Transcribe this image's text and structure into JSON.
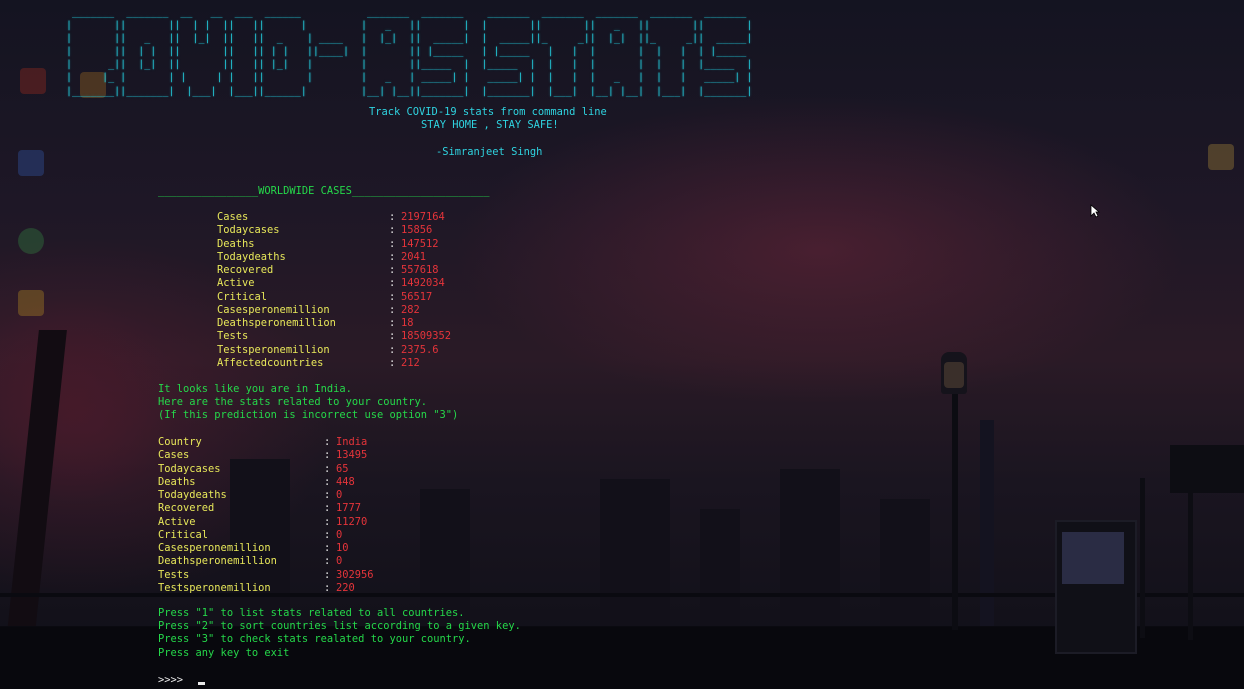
{
  "banner": {
    "ascii_art": " _______  _______  __   __  ___  ______           _______  _______    _______  _______  _______  _______  _______ \n|       ||       ||  | |  ||   ||      |         |   _   ||       |  |       ||       ||   _   ||       ||       |\n|       ||   _   ||  |_|  ||   ||  _    | ____   |  |_|  ||  _____|  |  _____||_     _||  |_|  ||_     _||  _____|\n|       ||  | |  ||       ||   || | |   ||____|  |       || |_____   | |_____   |   |  |       |  |   |  | |_____ \n|      _||  |_|  ||       ||   || |_|   |        |       ||_____  |  |_____  |  |   |  |       |  |   |  |_____  |\n|     |_ |       | |     | |   ||       |        |   _   | _____| |   _____| |  |   |  |   _   |  |   |   _____| |\n|_______||_______|  |___|  |___||______|         |__| |__||_______|  |_______|  |___|  |__| |__|  |___|  |_______|",
    "tagline_1": "Track COVID-19 stats from command line",
    "tagline_2": "STAY HOME , STAY SAFE!",
    "author": "-Simranjeet Singh"
  },
  "worldwide": {
    "header": "________________WORLDWIDE CASES______________________",
    "rows": [
      {
        "key": "Cases",
        "value": "2197164"
      },
      {
        "key": "Todaycases",
        "value": "15856"
      },
      {
        "key": "Deaths",
        "value": "147512"
      },
      {
        "key": "Todaydeaths",
        "value": "2041"
      },
      {
        "key": "Recovered",
        "value": "557618"
      },
      {
        "key": "Active",
        "value": "1492034"
      },
      {
        "key": "Critical",
        "value": "56517"
      },
      {
        "key": "Casesperonemillion",
        "value": "282"
      },
      {
        "key": "Deathsperonemillion",
        "value": "18"
      },
      {
        "key": "Tests",
        "value": "18509352"
      },
      {
        "key": "Testsperonemillion",
        "value": "2375.6"
      },
      {
        "key": "Affectedcountries",
        "value": "212"
      }
    ]
  },
  "location_msg": {
    "line_1": "It looks like you are in India.",
    "line_2": "Here are the stats related to your country.",
    "line_3": "(If this prediction is incorrect use option \"3\")"
  },
  "country": {
    "rows": [
      {
        "key": "Country",
        "value": "India"
      },
      {
        "key": "Cases",
        "value": "13495"
      },
      {
        "key": "Todaycases",
        "value": "65"
      },
      {
        "key": "Deaths",
        "value": "448"
      },
      {
        "key": "Todaydeaths",
        "value": "0"
      },
      {
        "key": "Recovered",
        "value": "1777"
      },
      {
        "key": "Active",
        "value": "11270"
      },
      {
        "key": "Critical",
        "value": "0"
      },
      {
        "key": "Casesperonemillion",
        "value": "10"
      },
      {
        "key": "Deathsperonemillion",
        "value": "0"
      },
      {
        "key": "Tests",
        "value": "302956"
      },
      {
        "key": "Testsperonemillion",
        "value": "220"
      }
    ]
  },
  "menu": {
    "option_1": "Press \"1\" to list stats related to all countries.",
    "option_2": "Press \"2\" to sort countries list according to a given key.",
    "option_3": "Press \"3\" to check stats realated to your country.",
    "option_exit": "Press any key to exit"
  },
  "prompt": {
    "symbol": ">>>>"
  },
  "colon": ":",
  "colors": {
    "banner": "#23c6d6",
    "message": "#25d84a",
    "key": "#e8e85a",
    "value": "#e5343a"
  }
}
